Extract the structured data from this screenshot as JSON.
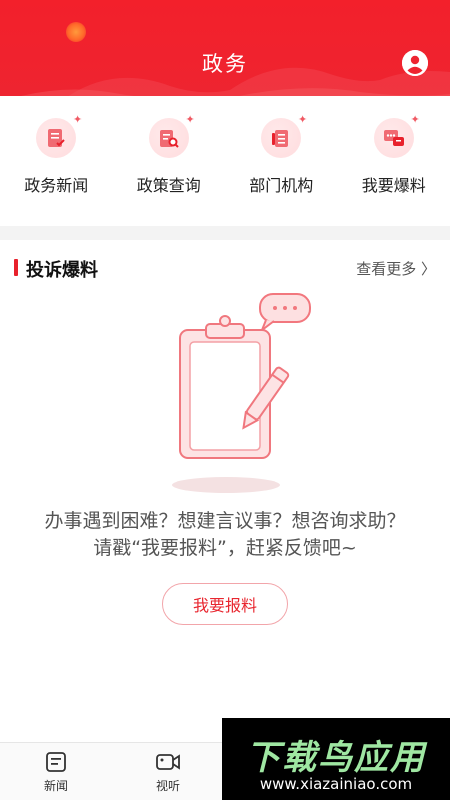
{
  "header": {
    "title": "政务",
    "bg_color": "#f0222d",
    "user_icon": "user-circle-icon"
  },
  "quick_menu": [
    {
      "label": "政务新闻",
      "icon": "news-doc-icon"
    },
    {
      "label": "政策查询",
      "icon": "policy-search-icon"
    },
    {
      "label": "部门机构",
      "icon": "department-icon"
    },
    {
      "label": "我要爆料",
      "icon": "chat-bubble-icon"
    }
  ],
  "complaint_section": {
    "title": "投诉爆料",
    "more": "查看更多 〉",
    "message_line1": "办事遇到困难？想建言议事？想咨询求助？",
    "message_line2": "请戳“我要报料”，赶紧反馈吧~",
    "button": "我要报料",
    "accent_color": "#e8212c"
  },
  "bottom_nav": [
    {
      "label": "新闻",
      "icon": "news-tab-icon"
    },
    {
      "label": "视听",
      "icon": "video-tab-icon"
    }
  ],
  "watermark": {
    "logo": "下载鸟应用",
    "url": "www.xiazainiao.com"
  }
}
